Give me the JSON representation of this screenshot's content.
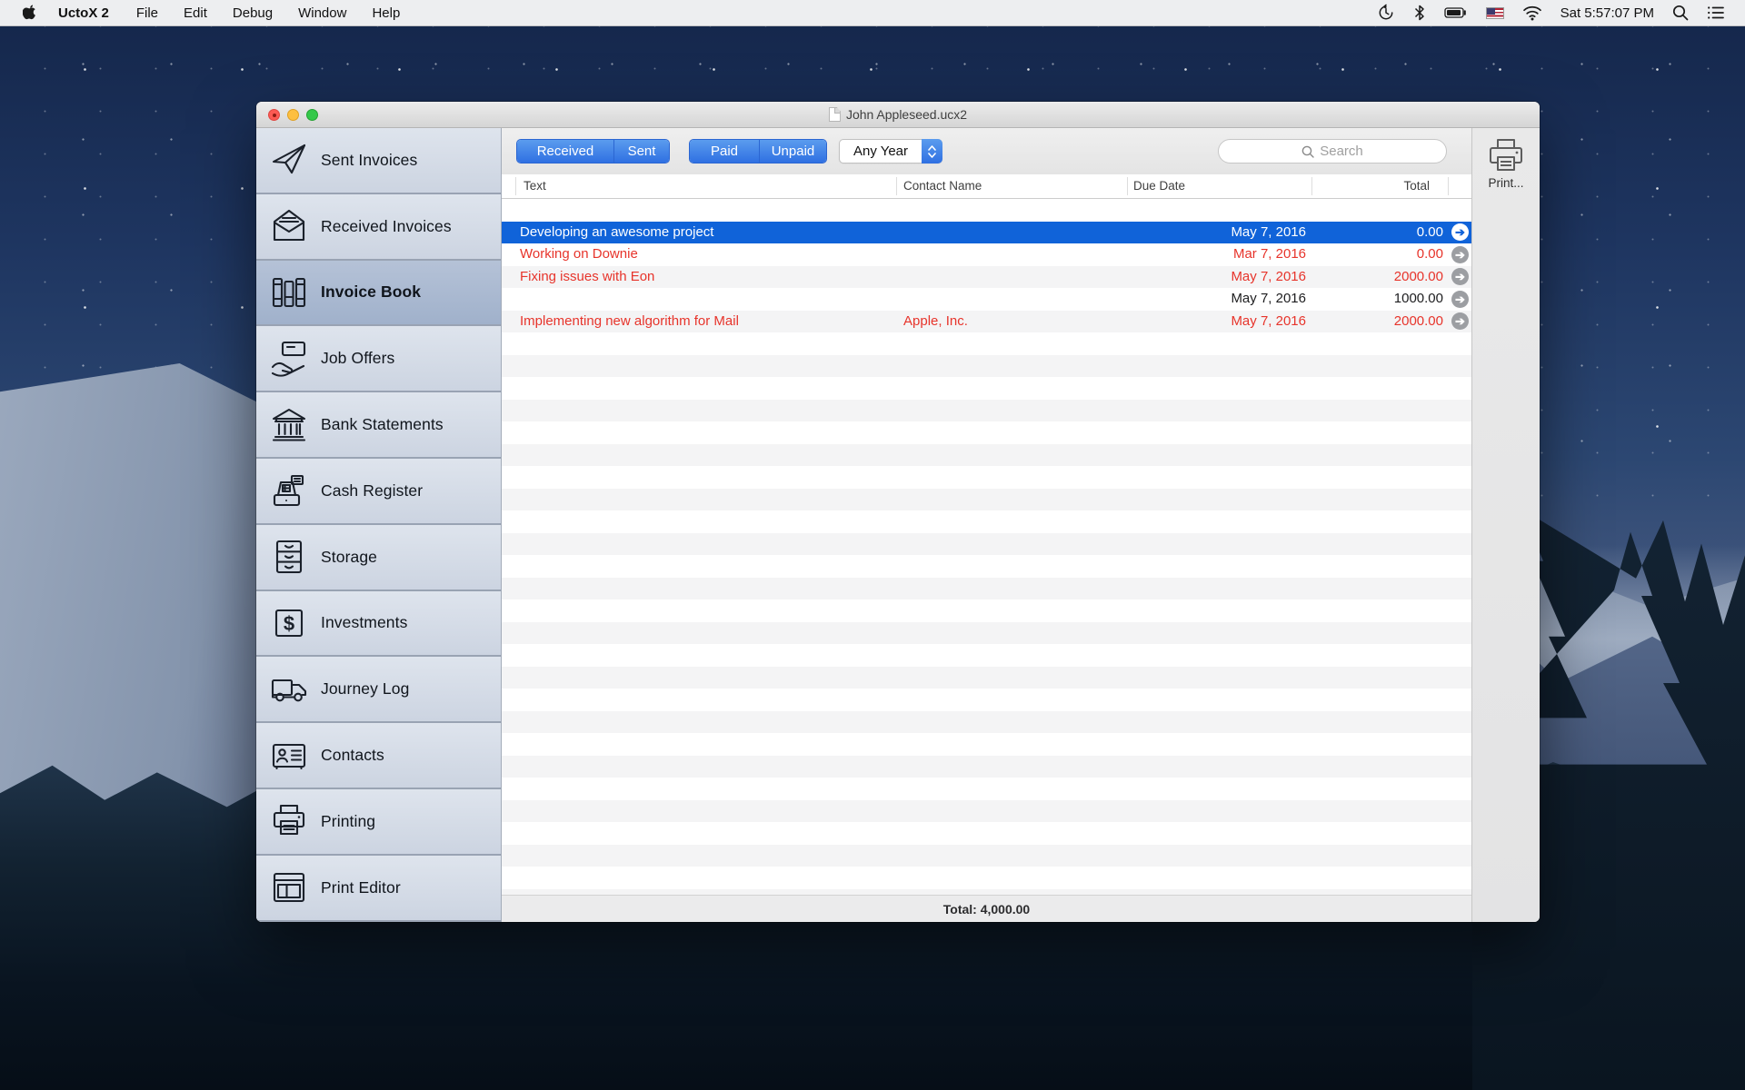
{
  "menu_bar": {
    "app_name": "UctoX 2",
    "menus": [
      "File",
      "Edit",
      "Debug",
      "Window",
      "Help"
    ],
    "status_icons": [
      "time-machine-icon",
      "bluetooth-icon",
      "battery-icon",
      "us-flag-icon",
      "wifi-icon"
    ],
    "clock": "Sat 5:57:07 PM",
    "trailing_icons": [
      "spotlight-icon",
      "notification-center-icon"
    ]
  },
  "window": {
    "title": "John Appleseed.ucx2",
    "sidebar": {
      "items": [
        {
          "label": "Sent Invoices",
          "icon": "paper-plane-icon",
          "selected": false
        },
        {
          "label": "Received Invoices",
          "icon": "envelope-open-icon",
          "selected": false
        },
        {
          "label": "Invoice Book",
          "icon": "books-icon",
          "selected": true
        },
        {
          "label": "Job Offers",
          "icon": "hand-card-icon",
          "selected": false
        },
        {
          "label": "Bank Statements",
          "icon": "bank-icon",
          "selected": false
        },
        {
          "label": "Cash Register",
          "icon": "cash-register-icon",
          "selected": false
        },
        {
          "label": "Storage",
          "icon": "drawers-icon",
          "selected": false
        },
        {
          "label": "Investments",
          "icon": "dollar-square-icon",
          "selected": false
        },
        {
          "label": "Journey Log",
          "icon": "truck-icon",
          "selected": false
        },
        {
          "label": "Contacts",
          "icon": "contact-card-icon",
          "selected": false
        },
        {
          "label": "Printing",
          "icon": "printer-icon",
          "selected": false
        },
        {
          "label": "Print Editor",
          "icon": "page-layout-icon",
          "selected": false
        }
      ]
    },
    "toolbar": {
      "received_sent_segments": [
        "Received",
        "Sent"
      ],
      "paid_unpaid_segments": [
        "Paid",
        "Unpaid"
      ],
      "year_filter_value": "Any Year",
      "search_placeholder": "Search",
      "print_label": "Print..."
    },
    "table": {
      "columns": {
        "text": "Text",
        "contact": "Contact Name",
        "due": "Due Date",
        "total": "Total"
      },
      "rows": [
        {
          "text": "Developing an awesome project",
          "contact": "",
          "due": "May 7, 2016",
          "total": "0.00",
          "selected": true,
          "highlight": "none"
        },
        {
          "text": "Working on Downie",
          "contact": "",
          "due": "Mar 7, 2016",
          "total": "0.00",
          "selected": false,
          "highlight": "red"
        },
        {
          "text": "Fixing issues with Eon",
          "contact": "",
          "due": "May 7, 2016",
          "total": "2000.00",
          "selected": false,
          "highlight": "red"
        },
        {
          "text": "",
          "contact": "",
          "due": "May 7, 2016",
          "total": "1000.00",
          "selected": false,
          "highlight": "none"
        },
        {
          "text": "Implementing new algorithm for Mail",
          "contact": "Apple, Inc.",
          "due": "May 7, 2016",
          "total": "2000.00",
          "selected": false,
          "highlight": "red"
        }
      ],
      "footer_total": "Total: 4,000.00"
    },
    "colors": {
      "selection_blue": "#1063d9",
      "unpaid_red": "#e7342b",
      "segment_blue": "#2f70e2"
    }
  }
}
